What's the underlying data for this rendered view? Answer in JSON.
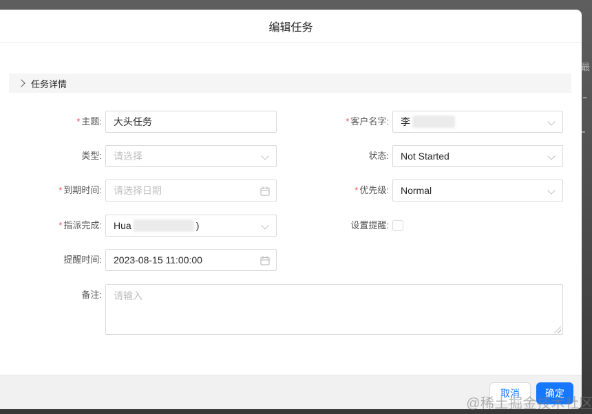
{
  "modal": {
    "title": "编辑任务",
    "section": {
      "title": "任务详情"
    },
    "footer": {
      "cancel": "取消",
      "ok": "确定"
    }
  },
  "required_marker": "*",
  "fields": {
    "subject": {
      "label": "主题:",
      "value": "大头任务"
    },
    "customer_name": {
      "label": "客户名字:",
      "value": "李"
    },
    "type": {
      "label": "类型:",
      "placeholder": "请选择"
    },
    "status": {
      "label": "状态:",
      "value": "Not Started"
    },
    "due_date": {
      "label": "到期时间:",
      "placeholder": "请选择日期"
    },
    "priority": {
      "label": "优先级:",
      "value": "Normal"
    },
    "assignee": {
      "label": "指派完成:",
      "value_start": "Hua",
      "value_end": ")"
    },
    "set_reminder": {
      "label": "设置提醒:"
    },
    "reminder_time": {
      "label": "提醒时间:",
      "value": "2023-08-15 11:00:00"
    },
    "notes": {
      "label": "备注:",
      "placeholder": "请输入"
    }
  },
  "background": {
    "partial_text": "最"
  },
  "watermark": "@稀土掘金技术社区",
  "colors": {
    "accent_blue": "#1677ff",
    "required_red": "#ff4d4f",
    "backdrop_dark": "#4c4c4c",
    "footer_gray": "#f1f1f2"
  }
}
